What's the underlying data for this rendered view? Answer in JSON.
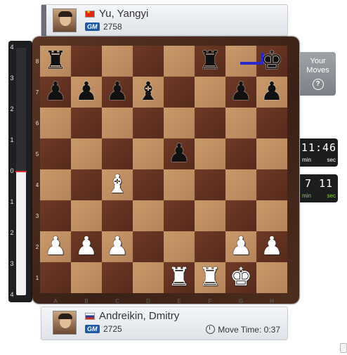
{
  "top_player": {
    "name": "Yu, Yangyi",
    "title": "GM",
    "rating": "2758",
    "flag": "china-flag"
  },
  "bottom_player": {
    "name": "Andreikin, Dmitry",
    "title": "GM",
    "rating": "2725",
    "flag": "russia-flag",
    "move_time_label": "Move Time: 0:37"
  },
  "side_panel": {
    "your_moves_line1": "Your",
    "your_moves_line2": "Moves",
    "help_glyph": "?"
  },
  "clocks": {
    "top": {
      "time": "11:46",
      "unit_left": "min",
      "unit_right": "sec"
    },
    "bottom": {
      "time": "7 11",
      "unit_left": "min",
      "unit_right": "sec"
    }
  },
  "eval_bar": {
    "ticks": [
      "4",
      "3",
      "2",
      "1",
      "0",
      "1",
      "2",
      "3",
      "4"
    ],
    "evaluation": 0.0
  },
  "board": {
    "files": [
      "A",
      "B",
      "C",
      "D",
      "E",
      "F",
      "G",
      "H"
    ],
    "ranks": [
      "8",
      "7",
      "6",
      "5",
      "4",
      "3",
      "2",
      "1"
    ],
    "position": [
      [
        "bR",
        "",
        "",
        "",
        "",
        "bR",
        "",
        "bK"
      ],
      [
        "bP",
        "bP",
        "bP",
        "bB",
        "",
        "",
        "bP",
        "bP"
      ],
      [
        "",
        "",
        "",
        "",
        "",
        "",
        "",
        ""
      ],
      [
        "",
        "",
        "",
        "",
        "bP",
        "",
        "",
        ""
      ],
      [
        "",
        "",
        "wB",
        "",
        "",
        "",
        "",
        ""
      ],
      [
        "",
        "",
        "",
        "",
        "",
        "",
        "",
        ""
      ],
      [
        "wP",
        "wP",
        "wP",
        "",
        "",
        "",
        "wP",
        "wP"
      ],
      [
        "",
        "",
        "",
        "",
        "wR",
        "wR",
        "wK",
        ""
      ]
    ],
    "last_move_arrow": {
      "from": "g8",
      "to": "h8"
    }
  }
}
